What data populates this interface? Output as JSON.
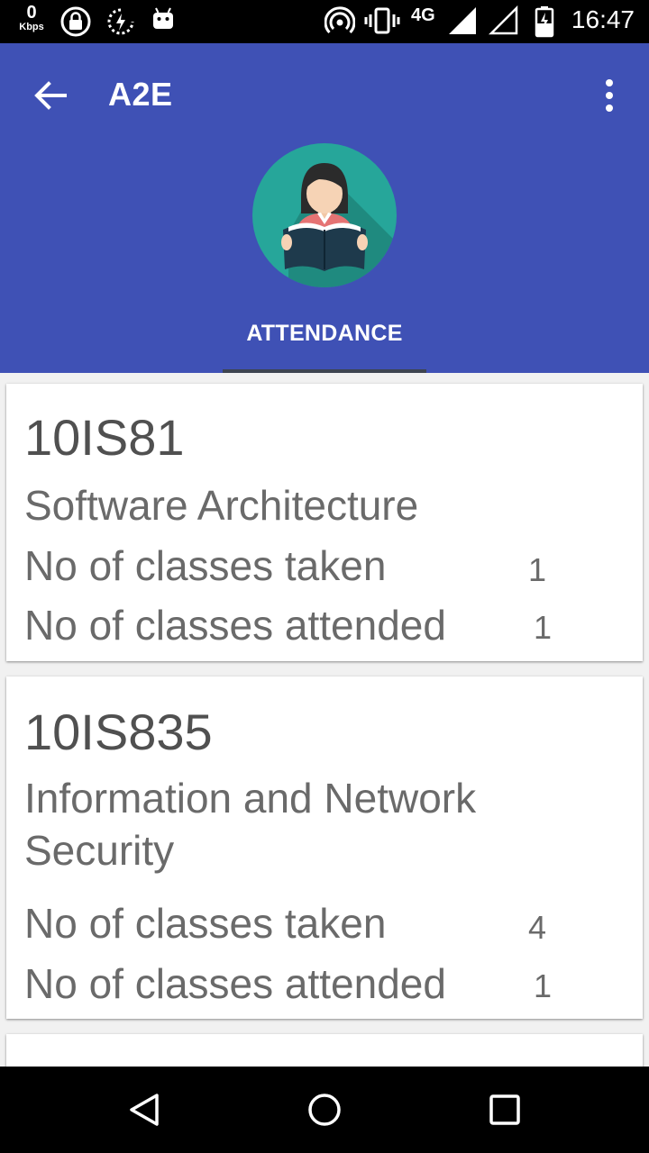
{
  "status_bar": {
    "net_speed": "0",
    "net_unit": "Kbps",
    "network": "4G",
    "time": "16:47"
  },
  "app_bar": {
    "title": "A2E",
    "tab_label": "ATTENDANCE",
    "colors": {
      "primary": "#3f51b5",
      "avatar_bg": "#26a69a"
    }
  },
  "courses": [
    {
      "code": "10IS81",
      "name": "Software Architecture",
      "taken_label": "No of classes taken",
      "taken": "1",
      "attended_label": "No of classes attended",
      "attended": "1"
    },
    {
      "code": "10IS835",
      "name": "Information and Network Security",
      "taken_label": "No of classes taken",
      "taken": "4",
      "attended_label": "No of classes attended",
      "attended": "1"
    }
  ]
}
